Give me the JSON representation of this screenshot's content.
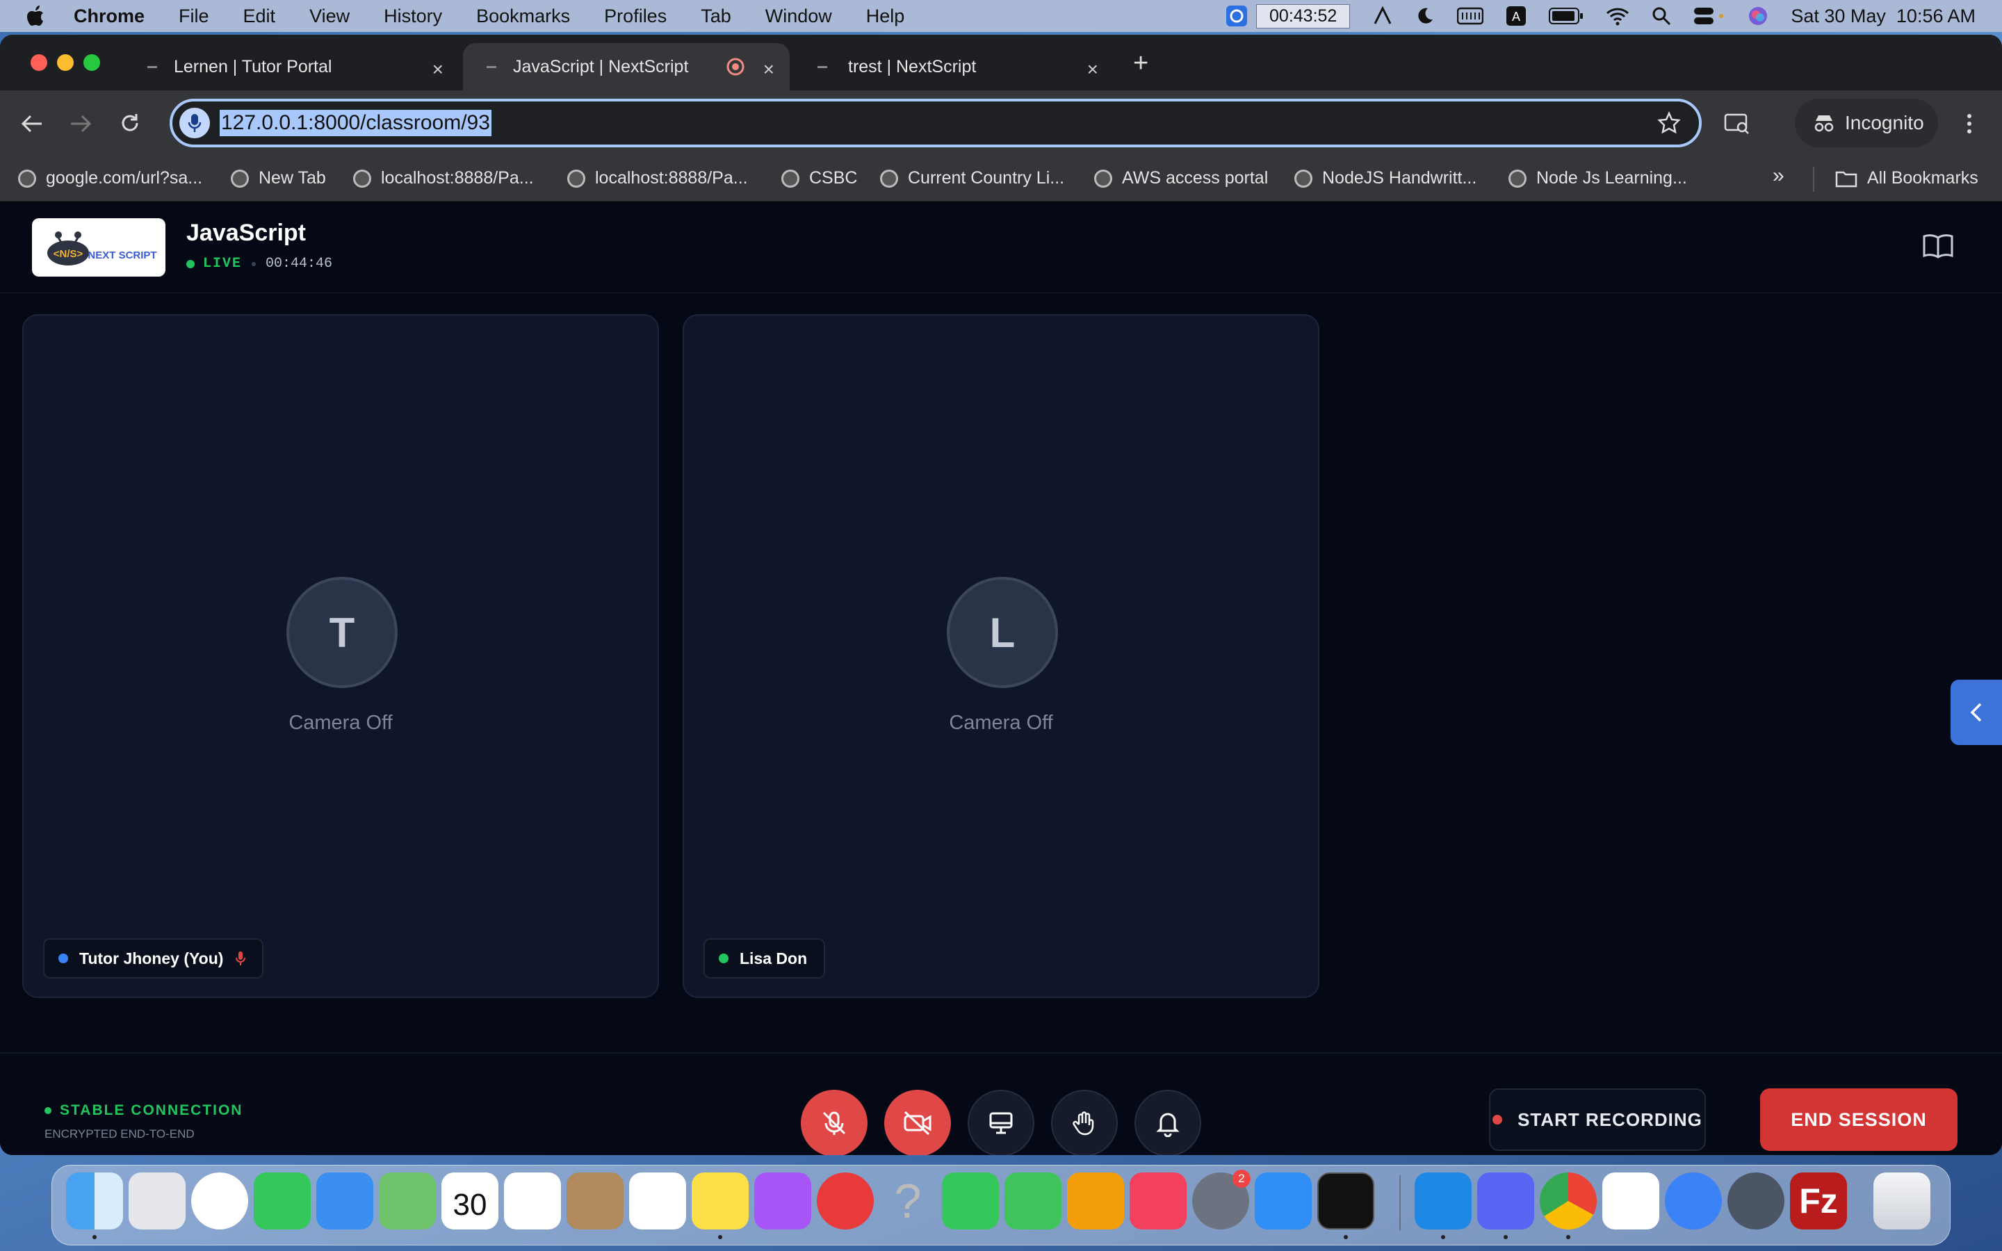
{
  "menubar": {
    "app": "Chrome",
    "items": [
      "File",
      "Edit",
      "View",
      "History",
      "Bookmarks",
      "Profiles",
      "Tab",
      "Window",
      "Help"
    ],
    "timer": "00:43:52",
    "datetime": "Sat 30 May  10:56 AM"
  },
  "tabs": [
    {
      "title": "Lernen | Tutor Portal"
    },
    {
      "title": "JavaScript | NextScript"
    },
    {
      "title": "trest | NextScript"
    }
  ],
  "omnibox": {
    "url": "127.0.0.1:8000/classroom/93"
  },
  "incognito_label": "Incognito",
  "bookmarks": [
    "google.com/url?sa...",
    "New Tab",
    "localhost:8888/Pa...",
    "localhost:8888/Pa...",
    "CSBC",
    "Current Country Li...",
    "AWS access portal",
    "NodeJS Handwritt...",
    "Node Js Learning..."
  ],
  "all_bookmarks": "All Bookmarks",
  "session": {
    "title": "JavaScript",
    "live_label": "LIVE",
    "elapsed": "00:44:46",
    "logo_text": "NEXT SCRIPT",
    "logo_mark": "<N/S>"
  },
  "participants": [
    {
      "initial": "T",
      "status": "Camera Off",
      "name": "Tutor Jhoney (You)",
      "dot_color": "#3b82f6"
    },
    {
      "initial": "L",
      "status": "Camera Off",
      "name": "Lisa Don",
      "dot_color": "#22c55e"
    }
  ],
  "footer": {
    "connection": "STABLE CONNECTION",
    "encryption": "ENCRYPTED END-TO-END",
    "record_label": "START RECORDING",
    "end_label": "END SESSION"
  },
  "dock_badges": {
    "system_settings": "2"
  },
  "colors": {
    "accent": "#3b73d9",
    "danger": "#e04848",
    "live": "#22c55e",
    "background": "#050916"
  }
}
